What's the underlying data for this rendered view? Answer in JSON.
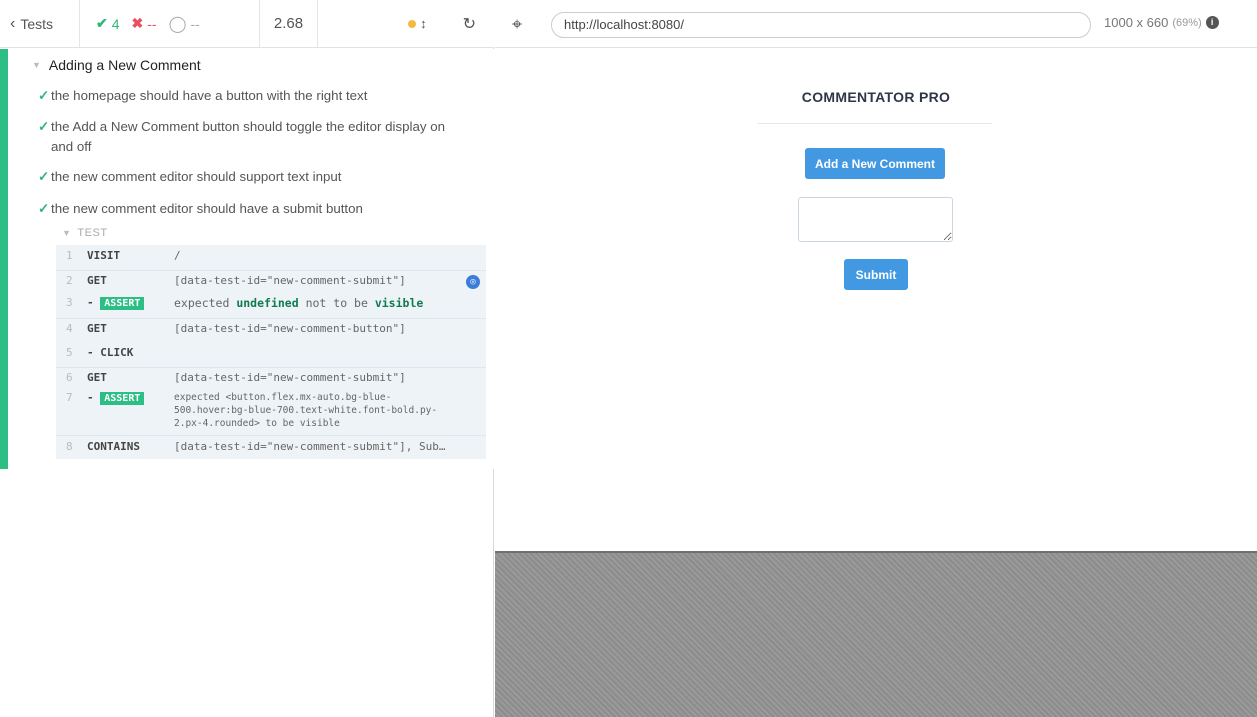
{
  "topbar": {
    "back_label": "Tests",
    "passed": "4",
    "failed": "--",
    "pending": "--",
    "duration": "2.68"
  },
  "suite": {
    "title": "Adding a New Comment",
    "tests": [
      "the homepage should have a button with the right text",
      "the Add a New Comment button should toggle the editor display on and off",
      "the new comment editor should support text input",
      "the new comment editor should have a submit button"
    ],
    "section_label": "TEST",
    "commands": [
      {
        "num": "1",
        "name": "VISIT",
        "msg": "/"
      },
      {
        "num": "2",
        "name": "GET",
        "msg": "[data-test-id=\"new-comment-submit\"]"
      },
      {
        "num": "3",
        "name": "- ASSERT",
        "msg_parts": [
          "expected",
          "undefined",
          "not to be",
          "visible"
        ]
      },
      {
        "num": "4",
        "name": "GET",
        "msg": "[data-test-id=\"new-comment-button\"]"
      },
      {
        "num": "5",
        "name": "- CLICK",
        "msg": ""
      },
      {
        "num": "6",
        "name": "GET",
        "msg": "[data-test-id=\"new-comment-submit\"]"
      },
      {
        "num": "7",
        "name": "- ASSERT",
        "msg_lines": [
          "expected <button.flex.mx-auto.bg-blue-",
          "500.hover:bg-blue-700.text-white.font-bold.py-",
          "2.px-4.rounded> to be visible"
        ]
      },
      {
        "num": "8",
        "name": "CONTAINS",
        "msg": "[data-test-id=\"new-comment-submit\"], Sub…"
      }
    ]
  },
  "browser": {
    "url": "http://localhost:8080/",
    "viewport": "1000 x 660",
    "zoom": "(69%)"
  },
  "app": {
    "title": "COMMENTATOR PRO",
    "add_button": "Add a New Comment",
    "submit_button": "Submit"
  },
  "colors": {
    "pass": "#33b67a",
    "fail": "#e94f5f",
    "accent": "#4299e1"
  }
}
